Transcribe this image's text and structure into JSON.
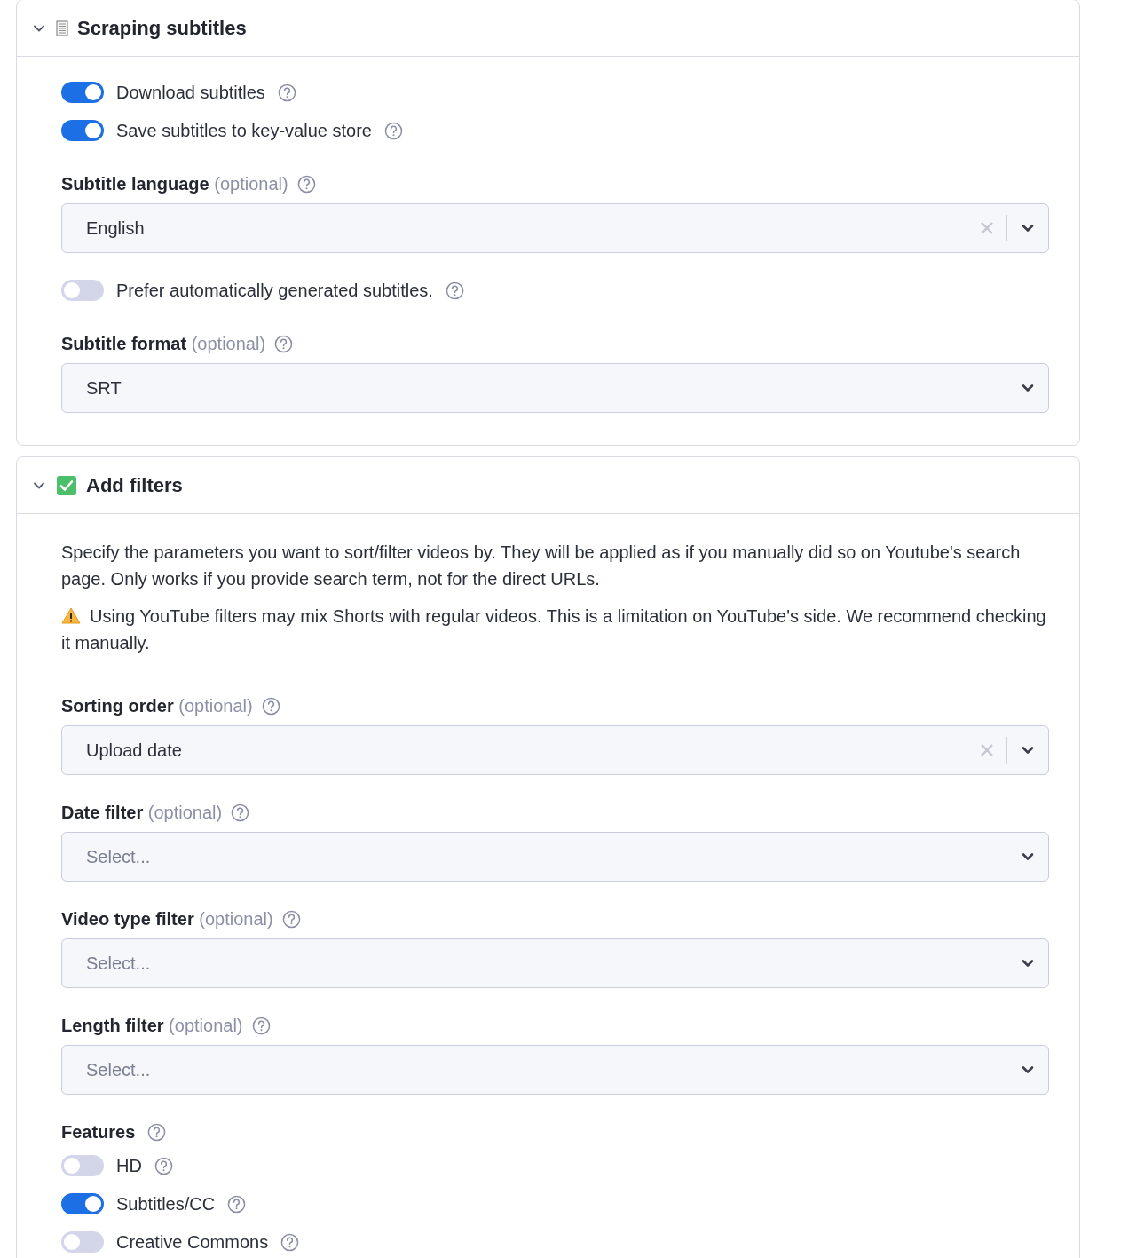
{
  "sections": [
    {
      "title": "Scraping subtitles",
      "kind": "page",
      "expanded": true,
      "items": [
        {
          "kind": "toggle",
          "label": "Download subtitles",
          "on": true
        },
        {
          "kind": "toggle",
          "label": "Save subtitles to key-value store",
          "on": true
        },
        {
          "kind": "select",
          "label": "Subtitle language",
          "optional": "(optional)",
          "value": "English",
          "clearable": true
        },
        {
          "kind": "toggle",
          "label": "Prefer automatically generated subtitles.",
          "on": false
        },
        {
          "kind": "select",
          "label": "Subtitle format",
          "optional": "(optional)",
          "value": "SRT",
          "clearable": false
        }
      ]
    },
    {
      "title": "Add filters",
      "kind": "check",
      "expanded": true,
      "items": [
        {
          "kind": "note",
          "text": "Specify the parameters you want to sort/filter videos by. They will be applied as if you manually did so on Youtube's search page. Only works if you provide search term, not for the direct URLs."
        },
        {
          "kind": "warning",
          "text": "Using YouTube filters may mix Shorts with regular videos. This is a limitation on YouTube's side. We recommend checking it manually."
        },
        {
          "kind": "select",
          "label": "Sorting order",
          "optional": "(optional)",
          "value": "Upload date",
          "clearable": true
        },
        {
          "kind": "select",
          "label": "Date filter",
          "optional": "(optional)",
          "placeholder": "Select...",
          "clearable": false
        },
        {
          "kind": "select",
          "label": "Video type filter",
          "optional": "(optional)",
          "placeholder": "Select...",
          "clearable": false
        },
        {
          "kind": "select",
          "label": "Length filter",
          "optional": "(optional)",
          "placeholder": "Select...",
          "clearable": false
        },
        {
          "kind": "group",
          "label": "Features",
          "toggles": [
            {
              "label": "HD",
              "on": false
            },
            {
              "label": "Subtitles/CC",
              "on": true
            },
            {
              "label": "Creative Commons",
              "on": false
            }
          ]
        }
      ]
    }
  ]
}
